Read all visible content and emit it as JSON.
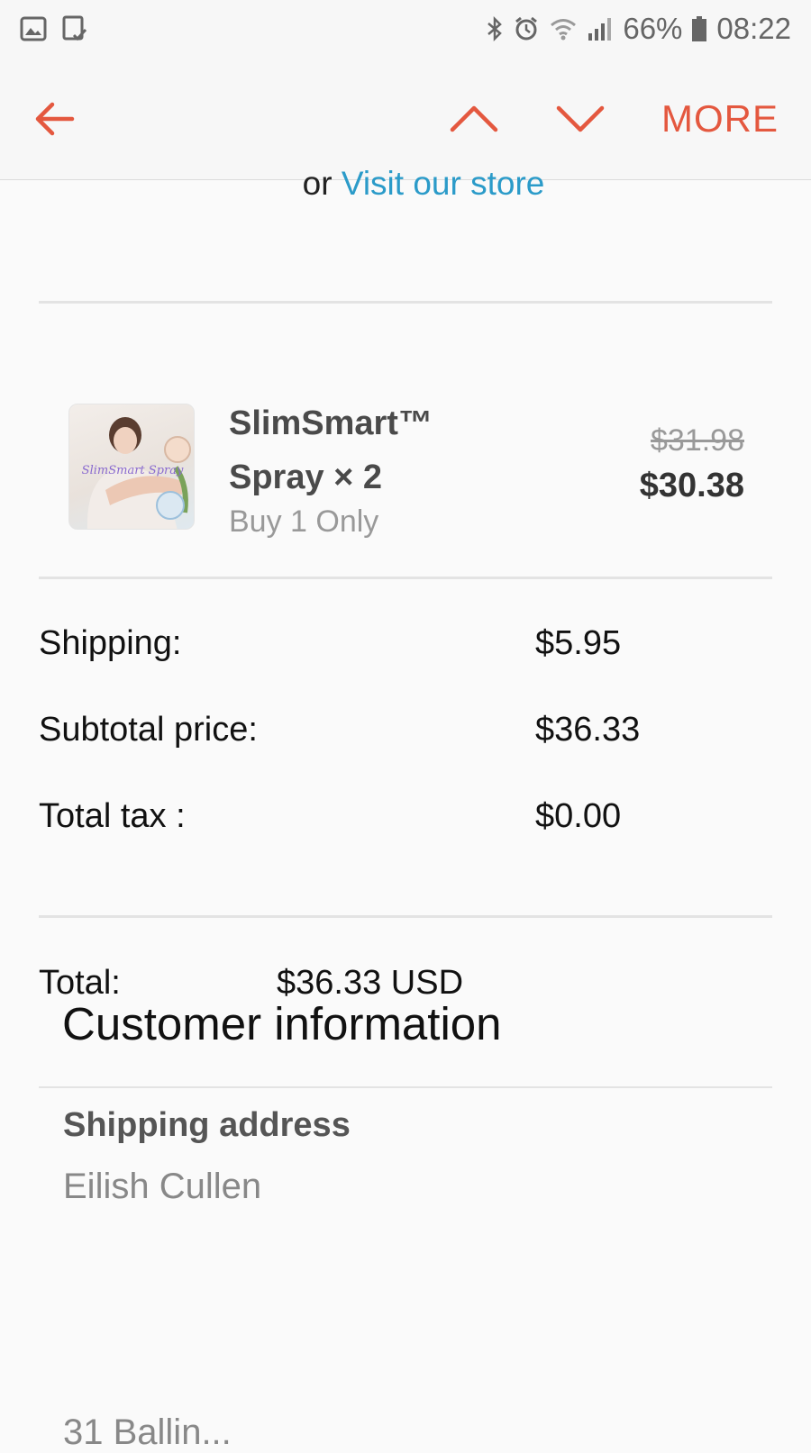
{
  "status_bar": {
    "battery": "66%",
    "time": "08:22",
    "left_icons": [
      "gallery-icon",
      "task-check-icon"
    ],
    "right_icons": [
      "bluetooth-icon",
      "alarm-icon",
      "wifi-icon",
      "signal-icon",
      "battery-icon"
    ]
  },
  "app_bar": {
    "more_label": "MORE",
    "accent_color": "#e4583f",
    "icons": [
      "back-arrow-icon",
      "chevron-up-icon",
      "chevron-down-icon"
    ]
  },
  "store": {
    "prefix": "or",
    "link_label": "Visit our store",
    "link_color": "#2b9bc9"
  },
  "product": {
    "name": "SlimSmart™ Spray × 2",
    "variant": "Buy 1 Only",
    "original_price": "$31.98",
    "price": "$30.38",
    "thumbnail_text": "SlimSmart Spray"
  },
  "summary": [
    {
      "label": "Shipping:",
      "value": "$5.95"
    },
    {
      "label": "Subtotal price:",
      "value": "$36.33"
    },
    {
      "label": "Total tax :",
      "value": "$0.00"
    }
  ],
  "total": {
    "label": "Total:",
    "value": "$36.33 USD"
  },
  "customer": {
    "title": "Customer information",
    "shipping_label": "Shipping address",
    "name": "Eilish Cullen",
    "address_partial": "31 Ballin..."
  }
}
